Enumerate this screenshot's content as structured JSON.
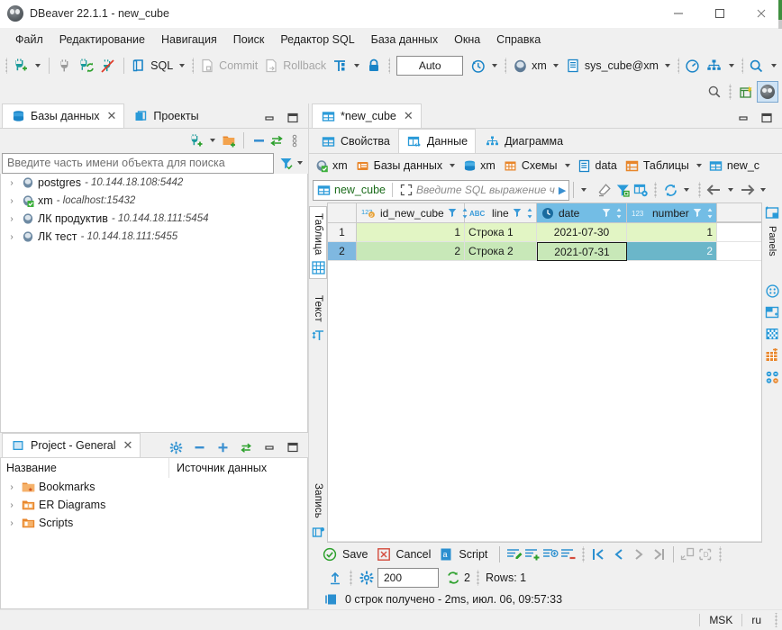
{
  "window": {
    "title": "DBeaver 22.1.1 - new_cube",
    "minimize": "–",
    "maximize": "□",
    "close": "✕"
  },
  "menubar": {
    "items": [
      {
        "label": "Файл"
      },
      {
        "label": "Редактирование"
      },
      {
        "label": "Навигация"
      },
      {
        "label": "Поиск"
      },
      {
        "label": "Редактор SQL"
      },
      {
        "label": "База данных"
      },
      {
        "label": "Окна"
      },
      {
        "label": "Справка"
      }
    ]
  },
  "toolbar": {
    "sql_label": "SQL",
    "commit_label": "Commit",
    "rollback_label": "Rollback",
    "auto_label": "Auto",
    "connection_label": "xm",
    "schema_label": "sys_cube@xm"
  },
  "db_navigator": {
    "tabs": [
      {
        "label": "Базы данных",
        "icon": "database-icon",
        "active": true,
        "closable": true
      },
      {
        "label": "Проекты",
        "icon": "projects-icon",
        "active": false,
        "closable": false
      }
    ],
    "filter_placeholder": "Введите часть имени объекта для поиска",
    "connections": [
      {
        "name": "postgres",
        "host": "- 10.144.18.108:5442",
        "connected": false
      },
      {
        "name": "xm",
        "host": "- localhost:15432",
        "connected": true
      },
      {
        "name": "ЛК продуктив",
        "host": "- 10.144.18.111:5454",
        "connected": false
      },
      {
        "name": "ЛК тест",
        "host": "- 10.144.18.111:5455",
        "connected": false
      }
    ]
  },
  "project_panel": {
    "tab_label": "Project - General",
    "columns": [
      "Название",
      "Источник данных"
    ],
    "items": [
      {
        "label": "Bookmarks"
      },
      {
        "label": "ER Diagrams"
      },
      {
        "label": "Scripts"
      }
    ]
  },
  "editor": {
    "tab_label": "*new_cube",
    "subtabs": [
      {
        "label": "Свойства",
        "active": false
      },
      {
        "label": "Данные",
        "active": true
      },
      {
        "label": "Диаграмма",
        "active": false
      }
    ],
    "breadcrumb": [
      {
        "label": "xm",
        "icon": "postgres-icon",
        "has_caret": false
      },
      {
        "label": "Базы данных",
        "icon": "databases-folder-icon",
        "has_caret": true
      },
      {
        "label": "xm",
        "icon": "db-stack-icon",
        "has_caret": false
      },
      {
        "label": "Схемы",
        "icon": "schemas-icon",
        "has_caret": true
      },
      {
        "label": "data",
        "icon": "schema-icon",
        "has_caret": false
      },
      {
        "label": "Таблицы",
        "icon": "tables-icon",
        "has_caret": true
      },
      {
        "label": "new_c",
        "icon": "table-icon",
        "has_caret": false
      }
    ],
    "sql_object": "new_cube",
    "sql_placeholder": "Введите SQL выражение ч"
  },
  "grid": {
    "left_tabs": [
      {
        "label": "Таблица",
        "icon": "grid-icon",
        "active": true
      },
      {
        "label": "Текст",
        "icon": "text-icon",
        "active": false
      },
      {
        "label": "Запись",
        "icon": "record-icon",
        "active": false
      }
    ],
    "right_panel_label": "Panels",
    "columns": [
      {
        "name": "id_new_cube",
        "type_icon": "123-key-icon",
        "selected": false,
        "width": 120
      },
      {
        "name": "line",
        "type_icon": "abc-icon",
        "selected": false,
        "width": 80
      },
      {
        "name": "date",
        "type_icon": "clock-icon",
        "selected": true,
        "width": 100
      },
      {
        "name": "number",
        "type_icon": "123-icon",
        "selected": true,
        "width": 100
      }
    ],
    "rows": [
      {
        "num": "1",
        "selected": false,
        "cells": [
          "1",
          "Строка 1",
          "2021-07-30",
          "1"
        ]
      },
      {
        "num": "2",
        "selected": true,
        "cells": [
          "2",
          "Строка 2",
          "2021-07-31",
          "2"
        ]
      }
    ]
  },
  "grid_toolbar": {
    "save_label": "Save",
    "cancel_label": "Cancel",
    "script_label": "Script",
    "fetch_size": "200",
    "refresh_count": "2",
    "rows_label": "Rows: 1"
  },
  "status": {
    "query_result": "0 строк получено - 2ms, июл. 06, 09:57:33",
    "timezone": "MSK",
    "locale": "ru"
  },
  "colors": {
    "accent": "#2a7fc1",
    "orange": "#e8862b",
    "green": "#3ea13e",
    "red": "#d44b3c",
    "selected_header": "#73bde5",
    "row_even": "#e2f5c4",
    "row_odd": "#c8e8b8",
    "selected_cell": "#6bb6c9"
  }
}
